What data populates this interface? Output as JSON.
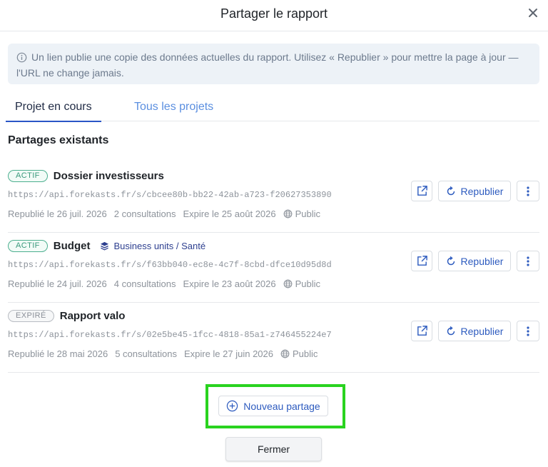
{
  "dialog": {
    "title": "Partager le rapport"
  },
  "info": {
    "text": "Un lien publie une copie des données actuelles du rapport. Utilisez « Republier » pour mettre la page à jour — l'URL ne change jamais."
  },
  "tabs": [
    {
      "label": "Projet en cours",
      "selected": true
    },
    {
      "label": "Tous les projets",
      "selected": false
    }
  ],
  "section": {
    "title": "Partages existants"
  },
  "shares": [
    {
      "status": "ACTIF",
      "name": "Dossier investisseurs",
      "scope": "",
      "url": "https://api.forekasts.fr/s/cbcee80b-bb22-42ab-a723-f20627353890",
      "republished": "Republié le 26 juil. 2026",
      "views": "2 consultations",
      "expires": "Expire le 25 août 2026",
      "visibility": "Public",
      "republish_label": "Republier"
    },
    {
      "status": "ACTIF",
      "name": "Budget",
      "scope": "Business units / Santé",
      "url": "https://api.forekasts.fr/s/f63bb040-ec8e-4c7f-8cbd-dfce10d95d8d",
      "republished": "Republié le 24 juil. 2026",
      "views": "4 consultations",
      "expires": "Expire le 23 août 2026",
      "visibility": "Public",
      "republish_label": "Republier"
    },
    {
      "status": "EXPIRÉ",
      "name": "Rapport valo",
      "scope": "",
      "url": "https://api.forekasts.fr/s/02e5be45-1fcc-4818-85a1-z746455224e7",
      "republished": "Republié le 28 mai 2026",
      "views": "5 consultations",
      "expires": "Expire le 27 juin 2026",
      "visibility": "Public",
      "republish_label": "Republier"
    }
  ],
  "actions": {
    "new_share_label": "Nouveau partage",
    "close_label": "Fermer"
  },
  "colors": {
    "accent": "#2d5bbf",
    "active_badge": "#3b9a7d",
    "expired_badge": "#8b9099",
    "highlight": "#29d31f",
    "info_bg": "#edf2f7"
  },
  "icons": {
    "close": "close-icon",
    "info": "info-icon",
    "open": "external-link-icon",
    "republish": "refresh-icon",
    "more": "more-vertical-icon",
    "layers": "layers-icon",
    "globe": "globe-icon",
    "add": "plus-circle-icon"
  }
}
